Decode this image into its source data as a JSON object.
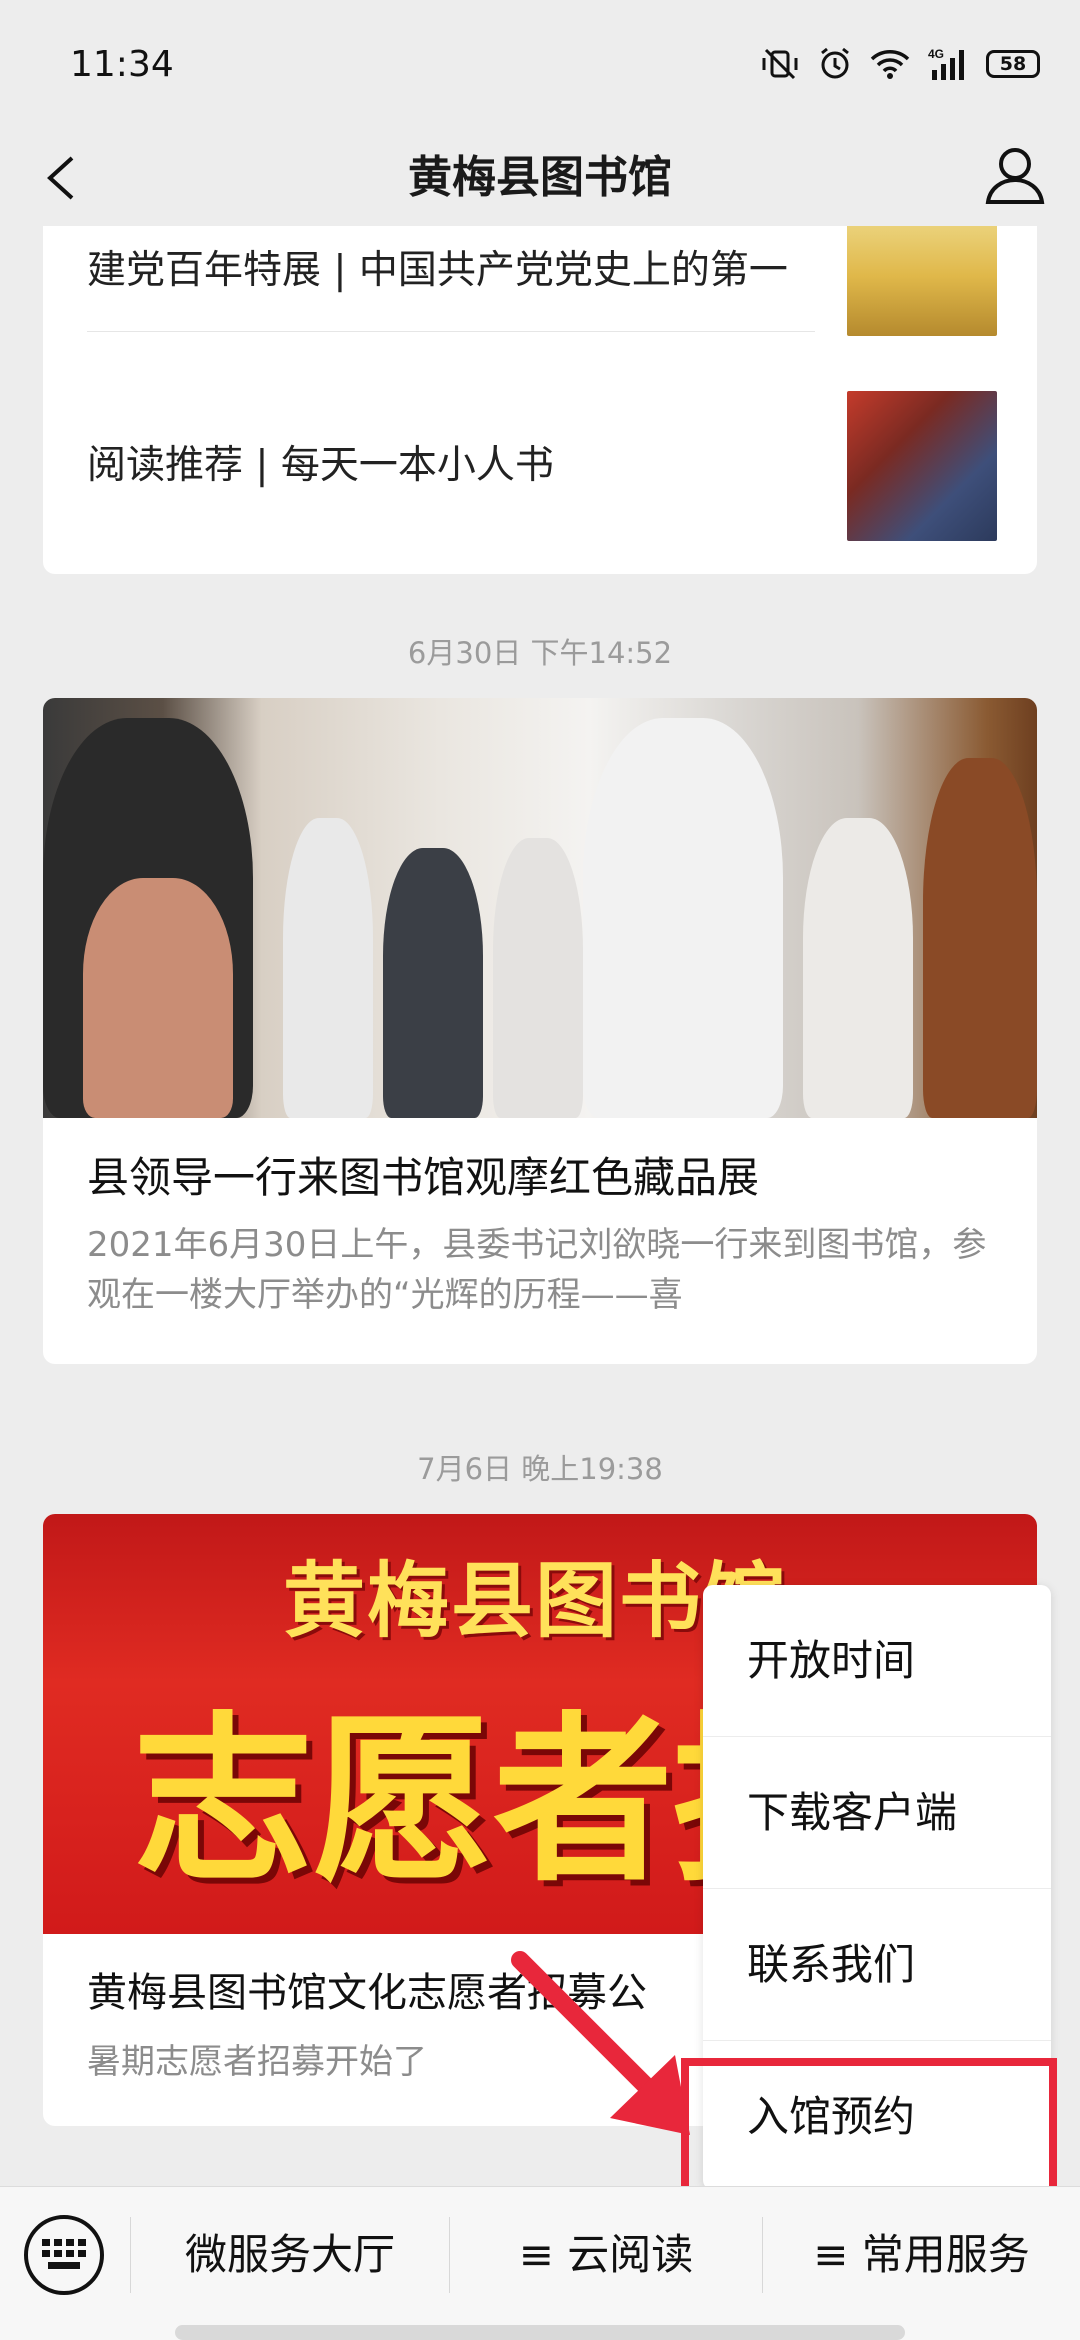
{
  "status_bar": {
    "time": "11:34",
    "network": "4G",
    "battery": "58"
  },
  "navbar": {
    "title": "黄梅县图书馆",
    "back_icon": "chevron-left-icon",
    "user_icon": "user-icon"
  },
  "feed": {
    "card1": {
      "items": [
        {
          "title": "建党百年特展 | 中国共产党党史上的第一"
        },
        {
          "title": "阅读推荐 | 每天一本小人书"
        }
      ]
    },
    "timestamp1": "6月30日 下午14:52",
    "card2": {
      "headline": "县领导一行来图书馆观摩红色藏品展",
      "summary": "2021年6月30日上午，县委书记刘欲晓一行来到图书馆，参观在一楼大厅举办的“光辉的历程——喜"
    },
    "timestamp2": "7月6日 晚上19:38",
    "card3": {
      "banner_line1": "黄梅县图书馆",
      "banner_line2": "志愿者招",
      "headline": "黄梅县图书馆文化志愿者招募公",
      "summary": "暑期志愿者招募开始了"
    }
  },
  "popup_menu": {
    "items": [
      "开放时间",
      "下载客户端",
      "联系我们",
      "入馆预约"
    ],
    "highlight_color": "#e8273b"
  },
  "bottom_menu": {
    "keyboard_icon": "keyboard-icon",
    "items": [
      "微服务大厅",
      "≡ 云阅读",
      "≡ 常用服务"
    ]
  }
}
